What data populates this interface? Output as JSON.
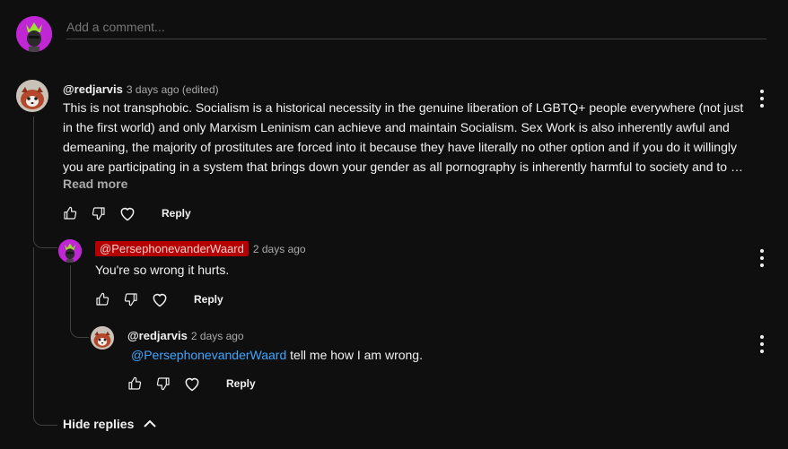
{
  "composer": {
    "placeholder": "Add a comment..."
  },
  "comment": {
    "author": "@redjarvis",
    "time": "3 days ago (edited)",
    "lines": [
      "This is not transphobic. Socialism is a historical necessity in the genuine liberation of LGBTQ+ people everywhere (not just",
      "in the first world) and only Marxism Leninism can achieve and maintain Socialism. Sex Work is also inherently awful and",
      "demeaning, the majority of prostitutes are forced into it because they have literally no other option and if you do it willingly",
      "you are participating in a system that brings down your gender as all pornography is inherently harmful to society and to …"
    ],
    "read_more": "Read more",
    "reply_label": "Reply"
  },
  "replies": [
    {
      "author": "@PersephonevanderWaard",
      "time": "2 days ago",
      "text": "You're so wrong it hurts.",
      "reply_label": "Reply"
    },
    {
      "author": "@redjarvis",
      "time": "2 days ago",
      "mention": "@PersephonevanderWaard",
      "text": " tell me how I am wrong.",
      "reply_label": "Reply"
    }
  ],
  "hide_replies_label": "Hide replies",
  "colors": {
    "background": "#0f0f0f",
    "text": "#f1f1f1",
    "secondary": "#aaaaaa",
    "link": "#3ea6ff",
    "chip": "#b40000",
    "avatar_user": "#c026d3"
  },
  "icons": [
    "like-icon",
    "dislike-icon",
    "heart-icon",
    "more-vert-icon",
    "chevron-up-icon"
  ]
}
